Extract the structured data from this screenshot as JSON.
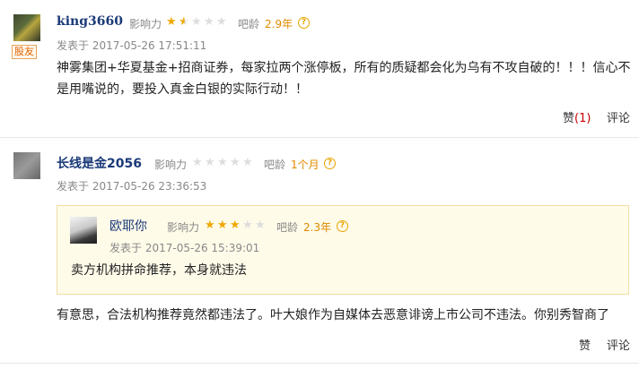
{
  "comments": [
    {
      "username": "king3660",
      "badge": "股友",
      "influence_label": "影响力",
      "influence_stars": 1.5,
      "age_label": "吧龄",
      "age_value": "2.9年",
      "help_icon": "question-circle-icon",
      "posted_label": "发表于",
      "posted_time": "2017-05-26 17:51:11",
      "content": "神雾集团+华夏基金+招商证券，每家拉两个涨停板，所有的质疑都会化为乌有不攻自破的！！！信心不是用嘴说的，要投入真金白银的实际行动！！",
      "like_label": "赞",
      "like_count": "(1)",
      "reply_label": "评论"
    },
    {
      "username": "长线是金2056",
      "influence_label": "影响力",
      "influence_stars": 0,
      "age_label": "吧龄",
      "age_value": "1个月",
      "help_icon": "question-circle-icon",
      "posted_label": "发表于",
      "posted_time": "2017-05-26 23:36:53",
      "quote": {
        "username": "欧耶你",
        "influence_label": "影响力",
        "influence_stars": 3,
        "age_label": "吧龄",
        "age_value": "2.3年",
        "posted_label": "发表于",
        "posted_time": "2017-05-26 15:39:01",
        "content": "卖方机构拼命推荐，本身就违法"
      },
      "content": "有意思，合法机构推荐竟然都违法了。叶大娘作为自媒体去恶意诽谤上市公司不违法。你别秀智商了",
      "like_label": "赞",
      "reply_label": "评论"
    }
  ],
  "colors": {
    "username": "#1a3a78",
    "star_on": "#f0a800",
    "star_off": "#dddddd",
    "age": "#e08a00",
    "quote_bg": "#fffbe9"
  }
}
